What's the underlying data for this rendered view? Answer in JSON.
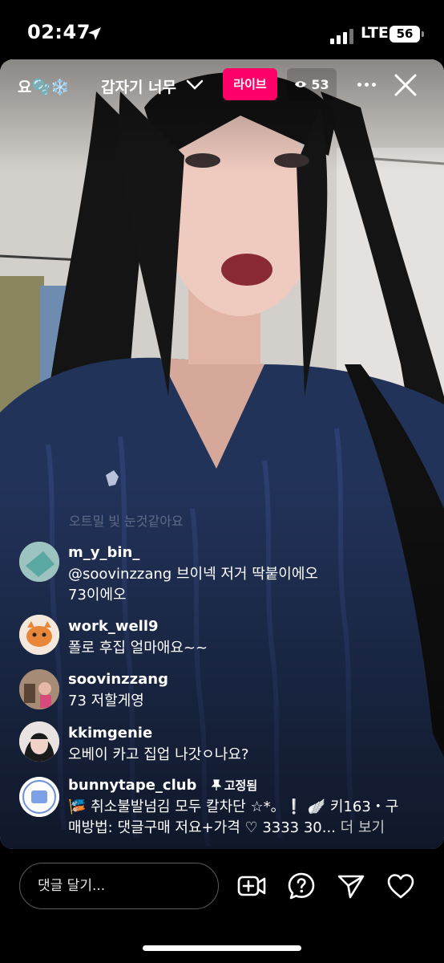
{
  "status_bar": {
    "time": "02:47",
    "network": "LTE",
    "battery": "56"
  },
  "live": {
    "host_name": "요🫧❄️",
    "title": "갑자기 너무",
    "badge": "라이브",
    "viewer_count": "53"
  },
  "faded_comment": "오트밀 빛 눈것같아요",
  "comments": [
    {
      "username": "m_y_bin_",
      "lines": [
        "@soovinzzang 브이넥 저거 딱붙이에오",
        "73이에오"
      ]
    },
    {
      "username": "work_well9",
      "lines": [
        "폴로 후집 얼마애요~~"
      ]
    },
    {
      "username": "soovinzzang",
      "lines": [
        "73 저할게영"
      ]
    },
    {
      "username": "kkimgenie",
      "lines": [
        "오베이 카고 집업 나갓ㅇ나요?"
      ]
    },
    {
      "username": "bunnytape_club",
      "pinned_label": "고정됨",
      "lines": [
        "🎏 취소불발넘김 모두 칼차단 ☆*。❕ 🪽 키163・구",
        "매방법: 댓글구매 저요+가격 ♡ 3333 30... "
      ],
      "more_label": "더 보기"
    }
  ],
  "bottom_bar": {
    "comment_placeholder": "댓글 달기..."
  },
  "colors": {
    "live_badge": "#ff0069",
    "background": "#000000"
  },
  "icons": [
    "location-arrow-icon",
    "signal-icon",
    "chevron-down-icon",
    "eye-icon",
    "more-icon",
    "close-icon",
    "pin-icon",
    "video-add-icon",
    "question-icon",
    "send-icon",
    "heart-icon"
  ]
}
